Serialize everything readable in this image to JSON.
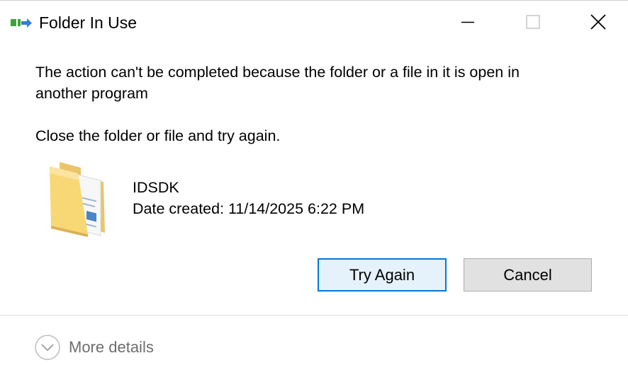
{
  "window": {
    "title": "Folder In Use",
    "app_icon": "transfer-arrow-icon",
    "controls": {
      "minimize": "minimize-icon",
      "maximize": "maximize-icon",
      "close": "close-icon"
    }
  },
  "message": {
    "line1": "The action can't be completed because the folder or a file in it is open in",
    "line2": "another program",
    "instruction": "Close the folder or file and try again."
  },
  "item": {
    "icon": "folder-icon",
    "name": "IDSDK",
    "date_created": "Date created: 11/14/2025 6:22 PM"
  },
  "buttons": {
    "try_again": "Try Again",
    "cancel": "Cancel"
  },
  "details": {
    "label": "More details",
    "icon": "chevron-down-circle-icon"
  },
  "colors": {
    "accent": "#0078d7",
    "primary_button_bg": "#e5f1fb",
    "secondary_button_bg": "#e1e1e1",
    "muted_text": "#6d6d6d"
  }
}
